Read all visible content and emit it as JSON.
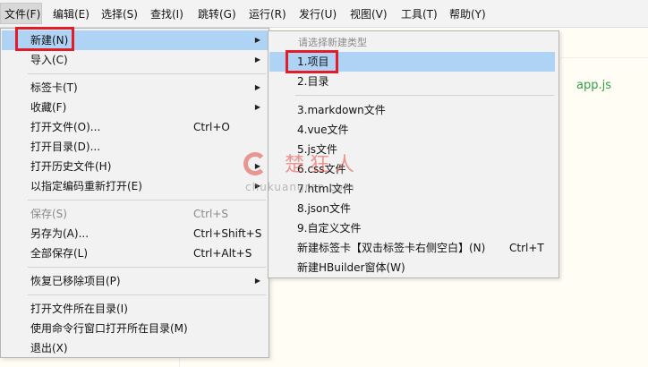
{
  "menubar": {
    "items": [
      "文件(F)",
      "编辑(E)",
      "选择(S)",
      "查找(I)",
      "跳转(G)",
      "运行(R)",
      "发行(U)",
      "视图(V)",
      "工具(T)",
      "帮助(Y)"
    ]
  },
  "editor": {
    "file_label": "app.js"
  },
  "file_menu": {
    "new": {
      "label": "新建(N)"
    },
    "import": {
      "label": "导入(C)"
    },
    "tabs": {
      "label": "标签卡(T)"
    },
    "favorites": {
      "label": "收藏(F)"
    },
    "open_file": {
      "label": "打开文件(O)...",
      "shortcut": "Ctrl+O"
    },
    "open_dir": {
      "label": "打开目录(D)..."
    },
    "open_history": {
      "label": "打开历史文件(H)"
    },
    "reopen_encoding": {
      "label": "以指定编码重新打开(E)"
    },
    "save": {
      "label": "保存(S)",
      "shortcut": "Ctrl+S"
    },
    "save_as": {
      "label": "另存为(A)...",
      "shortcut": "Ctrl+Shift+S"
    },
    "save_all": {
      "label": "全部保存(L)",
      "shortcut": "Ctrl+Alt+S"
    },
    "restore_removed": {
      "label": "恢复已移除项目(P)"
    },
    "open_containing": {
      "label": "打开文件所在目录(I)"
    },
    "open_cmd": {
      "label": "使用命令行窗口打开所在目录(M)"
    },
    "exit": {
      "label": "退出(X)"
    }
  },
  "new_submenu": {
    "title": "请选择新建类型",
    "items": [
      {
        "label": "1.项目"
      },
      {
        "label": "2.目录"
      },
      {
        "label": "3.markdown文件"
      },
      {
        "label": "4.vue文件"
      },
      {
        "label": "5.js文件"
      },
      {
        "label": "6.css文件"
      },
      {
        "label": "7.html文件"
      },
      {
        "label": "8.json文件"
      },
      {
        "label": "9.自定义文件"
      },
      {
        "label": "新建标签卡【双击标签卡右侧空白】(N)",
        "shortcut": "Ctrl+T"
      },
      {
        "label": "新建HBuilder窗体(W)"
      }
    ]
  },
  "watermark": {
    "cn": "楚狂人",
    "en": "chukuangren.com"
  },
  "colors": {
    "highlight": "#aed3f5",
    "red_box": "#e11d2a",
    "menu_bg": "#f2f2f2",
    "editor_bg": "#fffdf4",
    "file_label": "#2fa14b"
  }
}
